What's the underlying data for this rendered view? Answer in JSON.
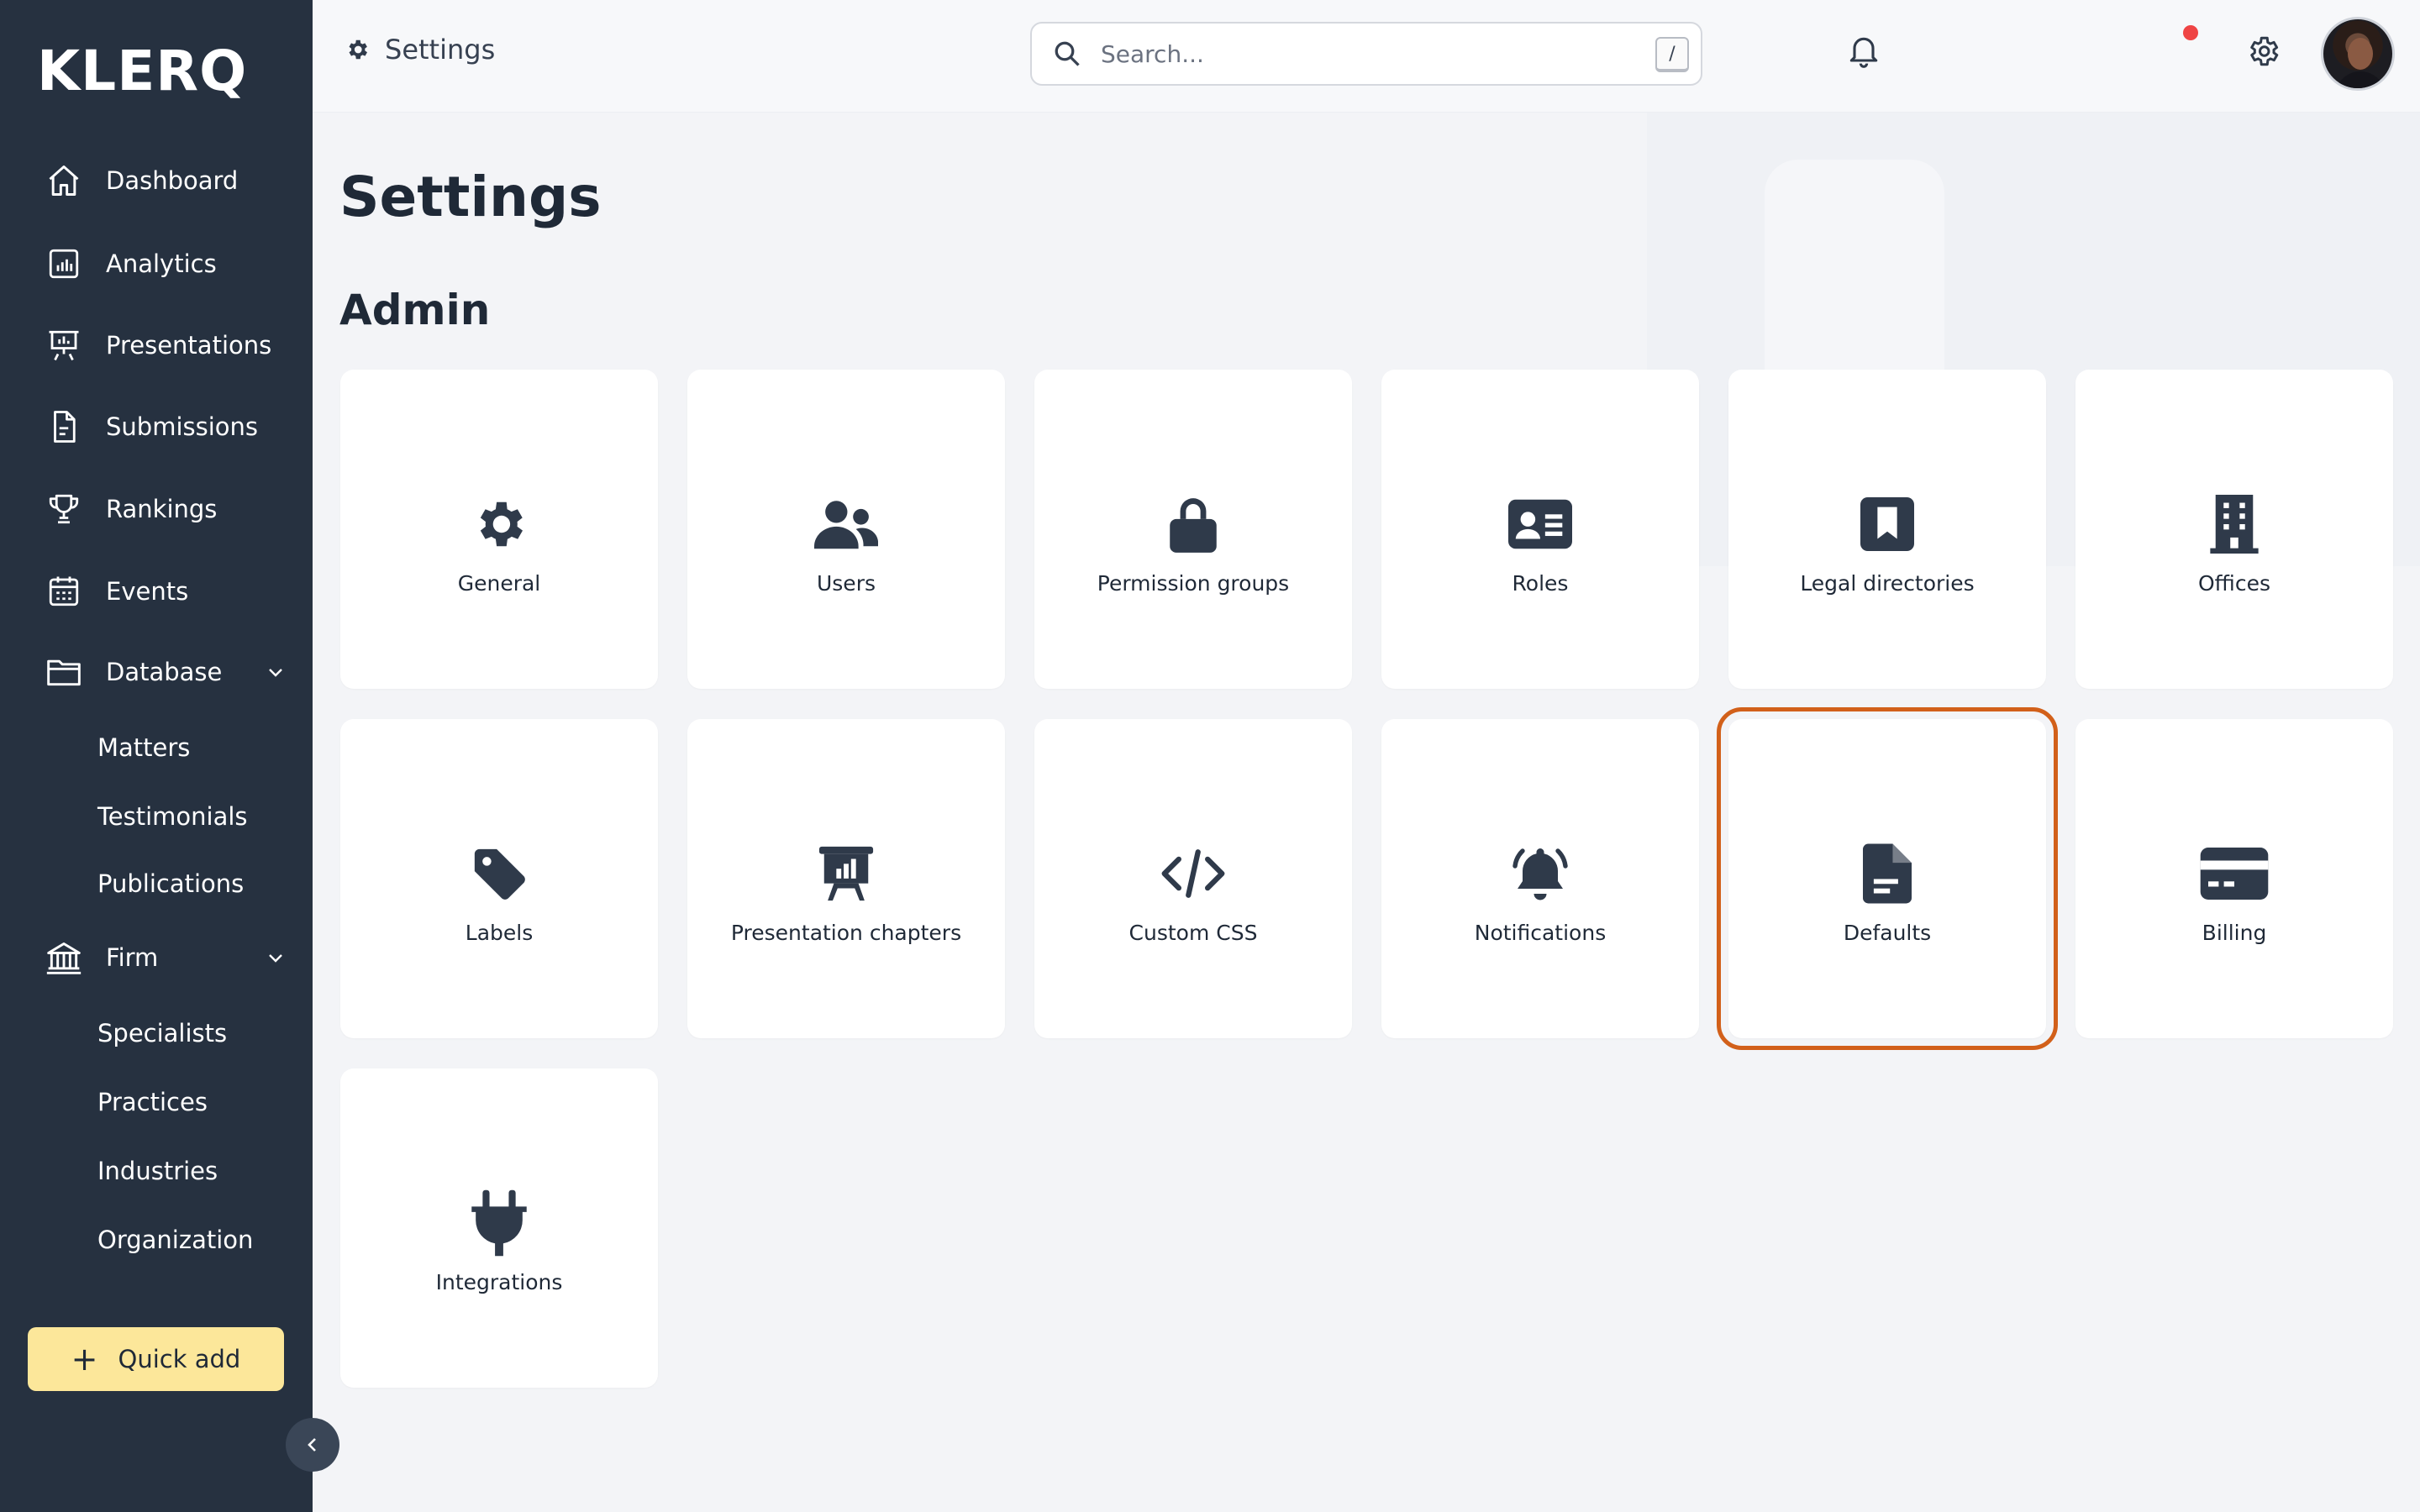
{
  "app": {
    "logo": "KLERQ"
  },
  "sidebar": {
    "items": [
      {
        "label": "Dashboard",
        "icon": "home-icon"
      },
      {
        "label": "Analytics",
        "icon": "analytics-icon"
      },
      {
        "label": "Presentations",
        "icon": "presentation-icon"
      },
      {
        "label": "Submissions",
        "icon": "document-icon"
      },
      {
        "label": "Rankings",
        "icon": "trophy-icon"
      },
      {
        "label": "Events",
        "icon": "calendar-icon"
      },
      {
        "label": "Database",
        "icon": "folder-icon",
        "expanded": true
      },
      {
        "label": "Firm",
        "icon": "bank-icon",
        "expanded": true
      }
    ],
    "database_sub": [
      "Matters",
      "Testimonials",
      "Publications"
    ],
    "firm_sub": [
      "Specialists",
      "Practices",
      "Industries",
      "Organization"
    ],
    "quick_add": "Quick add"
  },
  "topbar": {
    "breadcrumb": "Settings",
    "search_placeholder": "Search...",
    "search_shortcut": "/",
    "notification_dot_color": "#ef4444"
  },
  "main": {
    "title": "Settings",
    "section": "Admin",
    "cards": [
      {
        "label": "General",
        "icon": "gear-icon"
      },
      {
        "label": "Users",
        "icon": "users-icon"
      },
      {
        "label": "Permission groups",
        "icon": "lock-icon"
      },
      {
        "label": "Roles",
        "icon": "id-card-icon"
      },
      {
        "label": "Legal directories",
        "icon": "bookmark-icon"
      },
      {
        "label": "Offices",
        "icon": "building-icon"
      },
      {
        "label": "Labels",
        "icon": "tag-icon"
      },
      {
        "label": "Presentation chapters",
        "icon": "presentation-chart-icon"
      },
      {
        "label": "Custom CSS",
        "icon": "code-icon"
      },
      {
        "label": "Notifications",
        "icon": "bell-ring-icon"
      },
      {
        "label": "Defaults",
        "icon": "file-icon",
        "selected": true
      },
      {
        "label": "Billing",
        "icon": "credit-card-icon"
      },
      {
        "label": "Integrations",
        "icon": "plug-icon"
      }
    ]
  },
  "colors": {
    "sidebar_bg": "#263140",
    "quick_add_bg": "#fce79a",
    "selection_outline": "#d2601a",
    "icon_color": "#2f3a4a"
  }
}
